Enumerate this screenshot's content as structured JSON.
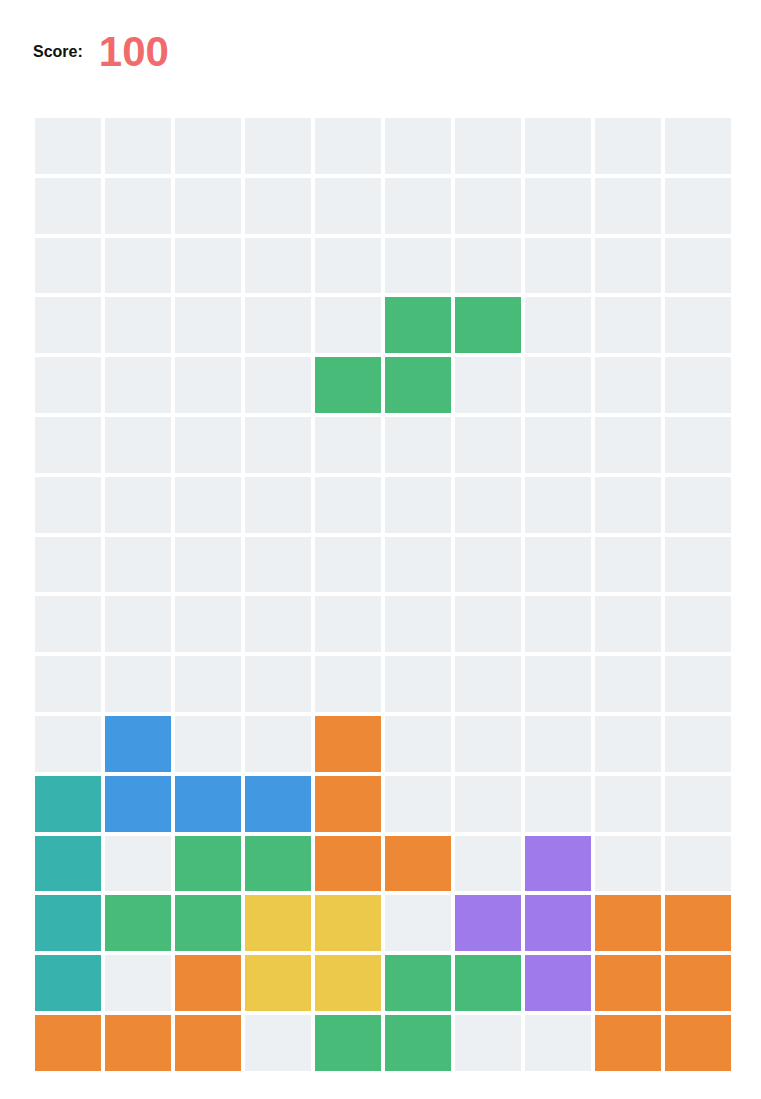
{
  "score": {
    "label": "Score:",
    "value": "100"
  },
  "board": {
    "rows": [
      [
        null,
        null,
        null,
        null,
        null,
        null,
        null,
        null,
        null,
        null
      ],
      [
        null,
        null,
        null,
        null,
        null,
        null,
        null,
        null,
        null,
        null
      ],
      [
        null,
        null,
        null,
        null,
        null,
        null,
        null,
        null,
        null,
        null
      ],
      [
        null,
        null,
        null,
        null,
        null,
        "#48bb78",
        "#48bb78",
        null,
        null,
        null
      ],
      [
        null,
        null,
        null,
        null,
        "#48bb78",
        "#48bb78",
        null,
        null,
        null,
        null
      ],
      [
        null,
        null,
        null,
        null,
        null,
        null,
        null,
        null,
        null,
        null
      ],
      [
        null,
        null,
        null,
        null,
        null,
        null,
        null,
        null,
        null,
        null
      ],
      [
        null,
        null,
        null,
        null,
        null,
        null,
        null,
        null,
        null,
        null
      ],
      [
        null,
        null,
        null,
        null,
        null,
        null,
        null,
        null,
        null,
        null
      ],
      [
        null,
        null,
        null,
        null,
        null,
        null,
        null,
        null,
        null,
        null
      ],
      [
        null,
        "#4299e1",
        null,
        null,
        "#ed8936",
        null,
        null,
        null,
        null,
        null
      ],
      [
        "#38b2ac",
        "#4299e1",
        "#4299e1",
        "#4299e1",
        "#ed8936",
        null,
        null,
        null,
        null,
        null
      ],
      [
        "#38b2ac",
        null,
        "#48bb78",
        "#48bb78",
        "#ed8936",
        "#ed8936",
        null,
        "#9f7aea",
        null,
        null
      ],
      [
        "#38b2ac",
        "#48bb78",
        "#48bb78",
        "#ecc94b",
        "#ecc94b",
        null,
        "#9f7aea",
        "#9f7aea",
        "#ed8936",
        "#ed8936"
      ],
      [
        "#38b2ac",
        null,
        "#ed8936",
        "#ecc94b",
        "#ecc94b",
        "#48bb78",
        "#48bb78",
        "#9f7aea",
        "#ed8936",
        "#ed8936"
      ],
      [
        "#ed8936",
        "#ed8936",
        "#ed8936",
        null,
        "#48bb78",
        "#48bb78",
        null,
        null,
        "#ed8936",
        "#ed8936"
      ]
    ]
  }
}
